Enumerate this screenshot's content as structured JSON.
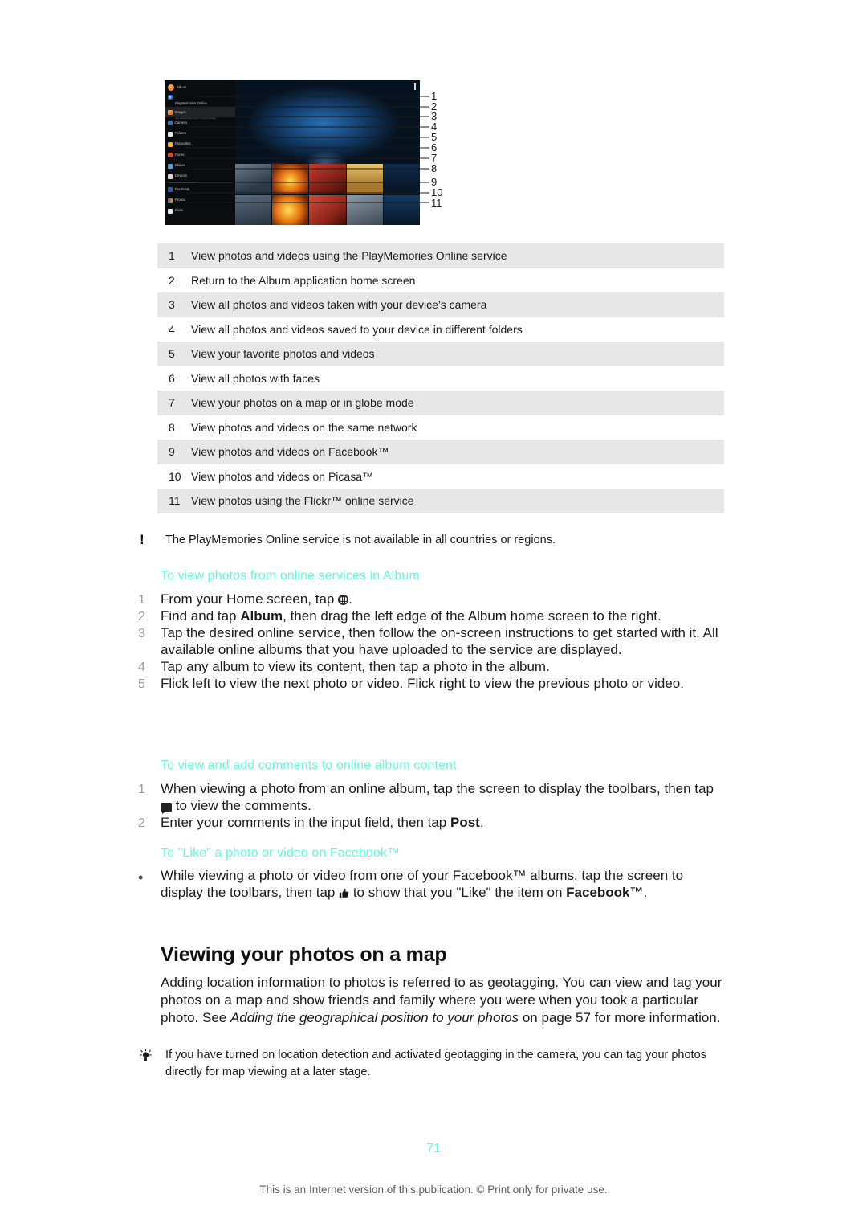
{
  "figure": {
    "screenshot": {
      "app_title": "Album",
      "overflow_icon": "more-vertical-icon",
      "drawer_items": [
        {
          "label": "PlayMemories Online",
          "sublabel": "Get started with Sony's cloud storage",
          "icon": "playmemories-icon"
        },
        {
          "label": "Images",
          "icon": "images-icon",
          "selected": true
        },
        {
          "label": "Camera",
          "icon": "camera-icon"
        },
        {
          "label": "Folders",
          "icon": "folder-icon"
        },
        {
          "label": "Favourites",
          "icon": "star-icon"
        },
        {
          "label": "Faces",
          "icon": "faces-icon"
        },
        {
          "label": "Places",
          "icon": "place-pin-icon"
        },
        {
          "label": "Devices",
          "icon": "devices-icon"
        },
        {
          "label": "Facebook",
          "icon": "facebook-icon"
        },
        {
          "label": "Picasa",
          "icon": "picasa-icon"
        },
        {
          "label": "Flickr",
          "icon": "flickr-icon"
        }
      ]
    },
    "callout_numbers": [
      "1",
      "2",
      "3",
      "4",
      "5",
      "6",
      "7",
      "8",
      "9",
      "10",
      "11"
    ]
  },
  "legend": [
    {
      "num": "1",
      "text": "View photos and videos using the PlayMemories Online service"
    },
    {
      "num": "2",
      "text": "Return to the Album application home screen"
    },
    {
      "num": "3",
      "text": "View all photos and videos taken with your device’s camera"
    },
    {
      "num": "4",
      "text": "View all photos and videos saved to your device in different folders"
    },
    {
      "num": "5",
      "text": "View your favorite photos and videos"
    },
    {
      "num": "6",
      "text": "View all photos with faces"
    },
    {
      "num": "7",
      "text": "View your photos on a map or in globe mode"
    },
    {
      "num": "8",
      "text": "View photos and videos on the same network"
    },
    {
      "num": "9",
      "text": "View photos and videos on Facebook™"
    },
    {
      "num": "10",
      "text": "View photos and videos on Picasa™"
    },
    {
      "num": "11",
      "text": "View photos using the Flickr™ online service"
    }
  ],
  "notes": {
    "warning": {
      "icon": "exclamation-icon",
      "text": "The PlayMemories Online service is not available in all countries or regions."
    },
    "tip": {
      "icon": "lightbulb-icon",
      "text": "If you have turned on location detection and activated geotagging in the camera, you can tag your photos directly for map viewing at a later stage."
    }
  },
  "sections": {
    "online_services": {
      "heading": "To view photos from online services in Album",
      "steps": [
        {
          "num": "1",
          "prefix": "From your Home screen, tap ",
          "icon": "apps-grid-icon",
          "suffix": "."
        },
        {
          "num": "2",
          "prefix": "Find and tap ",
          "bold": "Album",
          "suffix": ", then drag the left edge of the Album home screen to the right."
        },
        {
          "num": "3",
          "prefix": "Tap the desired online service, then follow the on-screen instructions to get started with it. All available online albums that you have uploaded to the service are displayed."
        },
        {
          "num": "4",
          "prefix": "Tap any album to view its content, then tap a photo in the album."
        },
        {
          "num": "5",
          "prefix": "Flick left to view the next photo or video. Flick right to view the previous photo or video."
        }
      ]
    },
    "comments": {
      "heading": "To view and add comments to online album content",
      "steps": [
        {
          "num": "1",
          "prefix": "When viewing a photo from an online album, tap the screen to display the toolbars, then tap ",
          "icon": "comment-icon",
          "suffix": " to view the comments."
        },
        {
          "num": "2",
          "prefix": "Enter your comments in the input field, then tap ",
          "bold": "Post",
          "suffix": "."
        }
      ]
    },
    "like": {
      "heading": "To \"Like\" a photo or video on Facebook™",
      "bullet": "•",
      "prefix": "While viewing a photo or video from one of your Facebook™ albums, tap the screen to display the toolbars, then tap ",
      "icon": "thumbs-up-icon",
      "middle": " to show that you \"Like\" the item on ",
      "bold": "Facebook™",
      "suffix": "."
    },
    "map": {
      "heading": "Viewing your photos on a map",
      "para_part1": "Adding location information to photos is referred to as geotagging. You can view and tag your photos on a map and show friends and family where you were when you took a particular photo. See ",
      "para_italic": "Adding the geographical position to your photos",
      "para_part2": " on page 57 for more information."
    }
  },
  "footer": {
    "page_number": "71",
    "notice": "This is an Internet version of this publication. © Print only for private use."
  }
}
